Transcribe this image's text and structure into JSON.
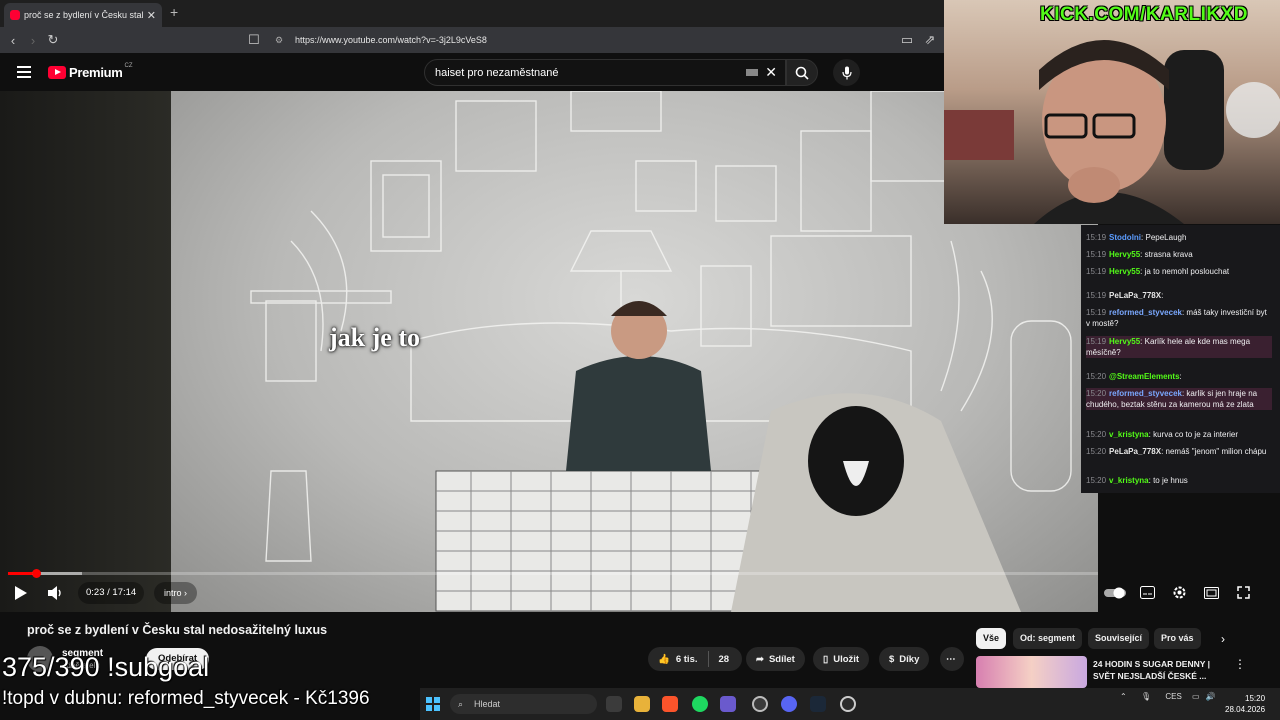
{
  "browser": {
    "tab_title": "proč se z bydlení v Česku stal",
    "url": "https://www.youtube.com/watch?v=-3j2L9cVeS8"
  },
  "youtube": {
    "logo_text": "Premium",
    "logo_cc": "CZ",
    "search_value": "haiset pro nezaměstnané",
    "caption": "jak je to",
    "time": "0:23 / 17:14",
    "progress": 0.022,
    "chapter": "intro",
    "video_title": "proč se z bydlení v Česku stal nedosažitelný luxus",
    "channel": "segment",
    "subscribers": "odběratelů",
    "subscribe_label": "Odebírat",
    "likes": "6 tis.",
    "dislikes": "28",
    "share_label": "Sdílet",
    "save_label": "Uložit",
    "thanks_label": "Díky",
    "chips": [
      "Vše",
      "Od: segment",
      "Související",
      "Pro vás"
    ],
    "rec_title": "24 HODIN S SUGAR DENNY | SVĚT NEJSLADŠÍ ČESKÉ ..."
  },
  "stream": {
    "kick_banner": "KICK.COM/KARLIKXD",
    "goal_text": "375/390 !subgoal",
    "topd_text": "!topd v dubnu: reformed_styvecek - Kč1396"
  },
  "chat": [
    {
      "time": "15:19",
      "user": "Stodolni",
      "color": "#5b9cff",
      "text": "PepeLaugh"
    },
    {
      "time": "15:19",
      "user": "Hervy55",
      "color": "#53fc18",
      "text": "strasna krava"
    },
    {
      "time": "15:19",
      "user": "Hervy55",
      "color": "#53fc18",
      "text": "ja to nemohl poslouchat"
    },
    {
      "time": "15:19",
      "user": "PeLaPa_778X",
      "color": "#e8e8e8",
      "text": ""
    },
    {
      "time": "15:19",
      "user": "reformed_styvecek",
      "color": "#7aa8ff",
      "text": "máš taky investiční byt v mostě?"
    },
    {
      "time": "15:19",
      "user": "Hervy55",
      "color": "#53fc18",
      "text": "Karlík hele ale kde mas mega měsíčně?"
    },
    {
      "time": "15:20",
      "user": "@StreamElements",
      "color": "#53fc18",
      "text": ""
    },
    {
      "time": "15:20",
      "user": "reformed_styvecek",
      "color": "#7aa8ff",
      "text": "karlik si jen hraje na chudého, beztak stěnu za kamerou má ze zlata"
    },
    {
      "time": "15:20",
      "user": "v_kristyna",
      "color": "#53fc18",
      "text": "kurva co to je za interier"
    },
    {
      "time": "15:20",
      "user": "PeLaPa_778X",
      "color": "#e8e8e8",
      "text": "nemáš \"jenom\" milion chápu"
    },
    {
      "time": "15:20",
      "user": "v_kristyna",
      "color": "#53fc18",
      "text": "to je hnus"
    }
  ],
  "taskbar": {
    "search_placeholder": "Hledat",
    "lang": "CES",
    "time": "15:20",
    "date": "28.04.2026"
  }
}
